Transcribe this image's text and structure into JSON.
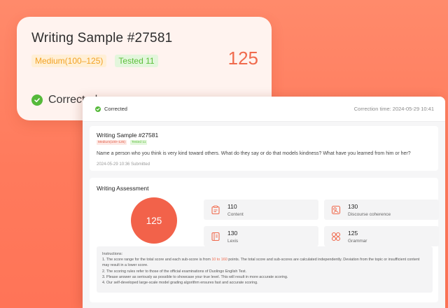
{
  "top_card": {
    "title": "Writing Sample #27581",
    "score": "125",
    "level_tag": "Medium(100–125)",
    "tested_tag": "Tested 11",
    "status": "Corrected"
  },
  "panel": {
    "status": "Corrected",
    "correction_time": "Correction time: 2024-05-29 10:41",
    "sample": {
      "title": "Writing Sample  #27581",
      "level_tag": "Medium(100–125)",
      "tested_tag": "Tested 11",
      "prompt": "Name a person who you think is very kind toward others. What do they say or do that models kindness? What have you learned from him or her?",
      "submitted": "2024-05-29 10:36 Submitted"
    },
    "assessment": {
      "title": "Writing Assessment",
      "total_score": "125",
      "metrics": [
        {
          "value": "110",
          "label": "Content",
          "icon": "content-icon"
        },
        {
          "value": "130",
          "label": "Discourse coherence",
          "icon": "coherence-icon"
        },
        {
          "value": "130",
          "label": "Lexis",
          "icon": "lexis-icon"
        },
        {
          "value": "125",
          "label": "Grammar",
          "icon": "grammar-icon"
        }
      ],
      "instructions": {
        "heading": "Instructions:",
        "line1_pre": "1. The score range for the total score and each sub-score is from ",
        "line1_range": "10 to 160",
        "line1_post": " points. The total score and sub-scores are calculated independently. Deviation from the topic or insufficient content may result in a lower score.",
        "line2": "2. The scoring rules refer to those of the official examinations of Duolingo English Test.",
        "line3": "3. Please answer as seriously as possible to showcase your true level. This will result in more accurate scoring.",
        "line4": "4. Our self-developed large-scale model grading algorithm ensures fast and accurate scoring."
      }
    }
  },
  "colors": {
    "accent": "#f06a4d",
    "success": "#55b93a",
    "tag_orange": "#f3a223"
  }
}
